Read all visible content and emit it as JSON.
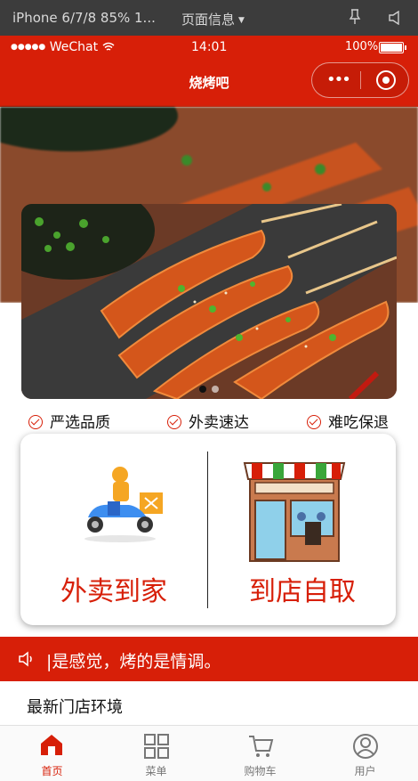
{
  "devtools": {
    "device": "iPhone 6/7/8 85% 1...",
    "page_info": "页面信息"
  },
  "statusbar": {
    "carrier": "WeChat",
    "time": "14:01",
    "battery": "100%"
  },
  "navbar": {
    "title": "烧烤吧"
  },
  "features": [
    "严选品质",
    "外卖速达",
    "难吃保退"
  ],
  "order_options": [
    {
      "label": "外卖到家",
      "icon": "delivery-scooter-icon"
    },
    {
      "label": "到店自取",
      "icon": "storefront-icon"
    }
  ],
  "notice": {
    "text": "|是感觉，烤的是情调。"
  },
  "section": {
    "title": "最新门店环境"
  },
  "tabbar": {
    "items": [
      {
        "label": "首页",
        "icon": "home-icon"
      },
      {
        "label": "菜单",
        "icon": "grid-menu-icon"
      },
      {
        "label": "购物车",
        "icon": "cart-icon"
      },
      {
        "label": "用户",
        "icon": "user-icon"
      }
    ],
    "active_index": 0
  },
  "banner": {
    "slides": 2,
    "active_slide": 0
  },
  "colors": {
    "brand_red": "#d71f08",
    "devtools_bg": "#3c3c3c",
    "tab_inactive": "#777777"
  }
}
